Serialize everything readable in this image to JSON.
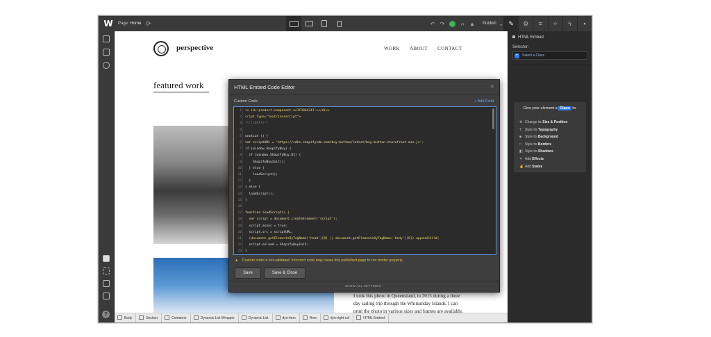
{
  "topbar": {
    "logo": "W",
    "page_prefix": "Page:",
    "page_name": "Home",
    "publish_label": "Publish"
  },
  "site": {
    "name": "perspective",
    "nav": [
      "WORK",
      "ABOUT",
      "CONTACT"
    ],
    "featured_heading": "featured work",
    "caption": "I took this photo in Queensland, in 2015 during a three day sailing trip through the Whitsunday Islands. I can print the photo in various sizes and frames are available."
  },
  "breadcrumb": [
    "Body",
    "Section",
    "Container",
    "Dynamic List Wrapper",
    "Dynamic List",
    "dyn-item",
    "Row",
    "dyn-right-col",
    "HTML Embed"
  ],
  "right_panel": {
    "title": "HTML Embed",
    "selector_label": "Selector:",
    "selector_placeholder": "Select a Class",
    "tips_head_pre": "Give your element a",
    "tips_head_badge": "Class",
    "tips_head_post": "to:",
    "tips": [
      {
        "icon": "✥",
        "pre": "Change its ",
        "bold": "Size & Position"
      },
      {
        "icon": "T",
        "pre": "Style its ",
        "bold": "Typography"
      },
      {
        "icon": "■",
        "pre": "Style its ",
        "bold": "Background"
      },
      {
        "icon": "□",
        "pre": "Style its ",
        "bold": "Borders"
      },
      {
        "icon": "◧",
        "pre": "Style its ",
        "bold": "Shadows"
      },
      {
        "icon": "✦",
        "pre": "Add ",
        "bold": "Effects"
      },
      {
        "icon": "☝",
        "pre": "Add ",
        "bold": "States"
      }
    ]
  },
  "modal": {
    "title": "HTML Embed Code Editor",
    "close": "×",
    "custom_code_label": "Custom Code:",
    "add_field": "+ Add Field",
    "code_lines": [
      {
        "n": "1",
        "t": "iv id='product-component-ec3f3064341'></div>"
      },
      {
        "n": "2",
        "t": "cript type=\"text/javascript\">"
      },
      {
        "n": "3",
        "t": "*<![CDATA[*/"
      },
      {
        "n": "4",
        "t": ""
      },
      {
        "n": "5",
        "t": "unction () {"
      },
      {
        "n": "6",
        "t": "var scriptURL = 'https://sdks.shopifycdn.com/buy-button/latest/buy-button-storefront.min.js';"
      },
      {
        "n": "7",
        "t": "if (window.ShopifyBuy) {"
      },
      {
        "n": "8",
        "t": "  if (window.ShopifyBuy.UI) {"
      },
      {
        "n": "9",
        "t": "    ShopifyBuyInit();"
      },
      {
        "n": "10",
        "t": "  } else {"
      },
      {
        "n": "11",
        "t": "    loadScript();"
      },
      {
        "n": "12",
        "t": "  }"
      },
      {
        "n": "13",
        "t": "} else {"
      },
      {
        "n": "14",
        "t": "  loadScript();"
      },
      {
        "n": "15",
        "t": "}"
      },
      {
        "n": "16",
        "t": ""
      },
      {
        "n": "17",
        "t": "function loadScript() {"
      },
      {
        "n": "18",
        "t": "  var script = document.createElement('script');"
      },
      {
        "n": "19",
        "t": "  script.async = true;"
      },
      {
        "n": "20",
        "t": "  script.src = scriptURL;"
      },
      {
        "n": "21",
        "t": "  (document.getElementsByTagName('head')[0] || document.getElementsByTagName('body')[0]).appendChild("
      },
      {
        "n": "22",
        "t": "  script.onload = ShopifyBuyInit;"
      },
      {
        "n": "23",
        "t": "}"
      }
    ],
    "warning": "Custom code is not validated. Incorrect code may cause this published page to not render properly.",
    "save": "Save",
    "save_close": "Save & Close",
    "show_all": "SHOW ALL SETTINGS"
  },
  "colors": {
    "accent": "#2f7ae5",
    "success": "#3cb35a",
    "warning": "#e9c14b"
  }
}
